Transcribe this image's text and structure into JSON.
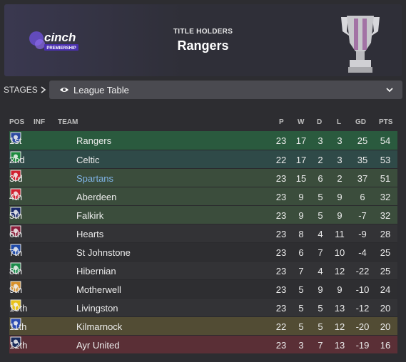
{
  "header": {
    "competition_logo": {
      "line1": "cinch",
      "line2": "PREMIERSHIP"
    },
    "holders_label": "TITLE HOLDERS",
    "holders_team": "Rangers"
  },
  "stages": {
    "label": "STAGES",
    "selected": "League Table"
  },
  "table": {
    "columns": {
      "pos": "POS",
      "inf": "INF",
      "team": "TEAM",
      "p": "P",
      "w": "W",
      "d": "D",
      "l": "L",
      "gd": "GD",
      "pts": "PTS"
    },
    "rows": [
      {
        "pos": "1st",
        "team": "Rangers",
        "p": "23",
        "w": "17",
        "d": "3",
        "l": "3",
        "gd": "25",
        "pts": "54",
        "zone": "#2a5a3e",
        "badge": "#2c4aa0",
        "badge_icon": "rangers-crest-icon"
      },
      {
        "pos": "2nd",
        "team": "Celtic",
        "p": "22",
        "w": "17",
        "d": "2",
        "l": "3",
        "gd": "35",
        "pts": "53",
        "zone": "#2f4a48",
        "badge": "#1e8a3e",
        "badge_icon": "celtic-crest-icon"
      },
      {
        "pos": "3rd",
        "team": "Spartans",
        "p": "23",
        "w": "15",
        "d": "6",
        "l": "2",
        "gd": "37",
        "pts": "51",
        "zone": "#3b4d3c",
        "badge": "#d02030",
        "badge_icon": "spartans-crest-icon",
        "highlight": true
      },
      {
        "pos": "4th",
        "team": "Aberdeen",
        "p": "23",
        "w": "9",
        "d": "5",
        "l": "9",
        "gd": "6",
        "pts": "32",
        "zone": "#3b4d3c",
        "badge": "#d02030",
        "badge_icon": "aberdeen-crest-icon"
      },
      {
        "pos": "5th",
        "team": "Falkirk",
        "p": "23",
        "w": "9",
        "d": "5",
        "l": "9",
        "gd": "-7",
        "pts": "32",
        "zone": "#3b4d3c",
        "badge": "#1a2a6a",
        "badge_icon": "falkirk-crest-icon"
      },
      {
        "pos": "6th",
        "team": "Hearts",
        "p": "23",
        "w": "8",
        "d": "4",
        "l": "11",
        "gd": "-9",
        "pts": "28",
        "zone": "#333336",
        "badge": "#8a1e3a",
        "badge_icon": "hearts-crest-icon"
      },
      {
        "pos": "7th",
        "team": "St Johnstone",
        "p": "23",
        "w": "6",
        "d": "7",
        "l": "10",
        "gd": "-4",
        "pts": "25",
        "zone": "#2e2e31",
        "badge": "#1f4aa8",
        "badge_icon": "st-johnstone-crest-icon"
      },
      {
        "pos": "8th",
        "team": "Hibernian",
        "p": "23",
        "w": "7",
        "d": "4",
        "l": "12",
        "gd": "-22",
        "pts": "25",
        "zone": "#333336",
        "badge": "#1a8a4a",
        "badge_icon": "hibernian-crest-icon"
      },
      {
        "pos": "9th",
        "team": "Motherwell",
        "p": "23",
        "w": "5",
        "d": "9",
        "l": "9",
        "gd": "-10",
        "pts": "24",
        "zone": "#2e2e31",
        "badge": "#d8902a",
        "badge_icon": "motherwell-crest-icon"
      },
      {
        "pos": "10th",
        "team": "Livingston",
        "p": "23",
        "w": "5",
        "d": "5",
        "l": "13",
        "gd": "-12",
        "pts": "20",
        "zone": "#333336",
        "badge": "#e8c21a",
        "badge_icon": "livingston-crest-icon"
      },
      {
        "pos": "11th",
        "team": "Kilmarnock",
        "p": "22",
        "w": "5",
        "d": "5",
        "l": "12",
        "gd": "-20",
        "pts": "20",
        "zone": "#524c34",
        "badge": "#2a4ab0",
        "badge_icon": "kilmarnock-crest-icon"
      },
      {
        "pos": "12th",
        "team": "Ayr United",
        "p": "23",
        "w": "3",
        "d": "7",
        "l": "13",
        "gd": "-19",
        "pts": "16",
        "zone": "#5a2f36",
        "badge": "#1a2a5a",
        "badge_icon": "ayr-united-crest-icon"
      }
    ]
  }
}
